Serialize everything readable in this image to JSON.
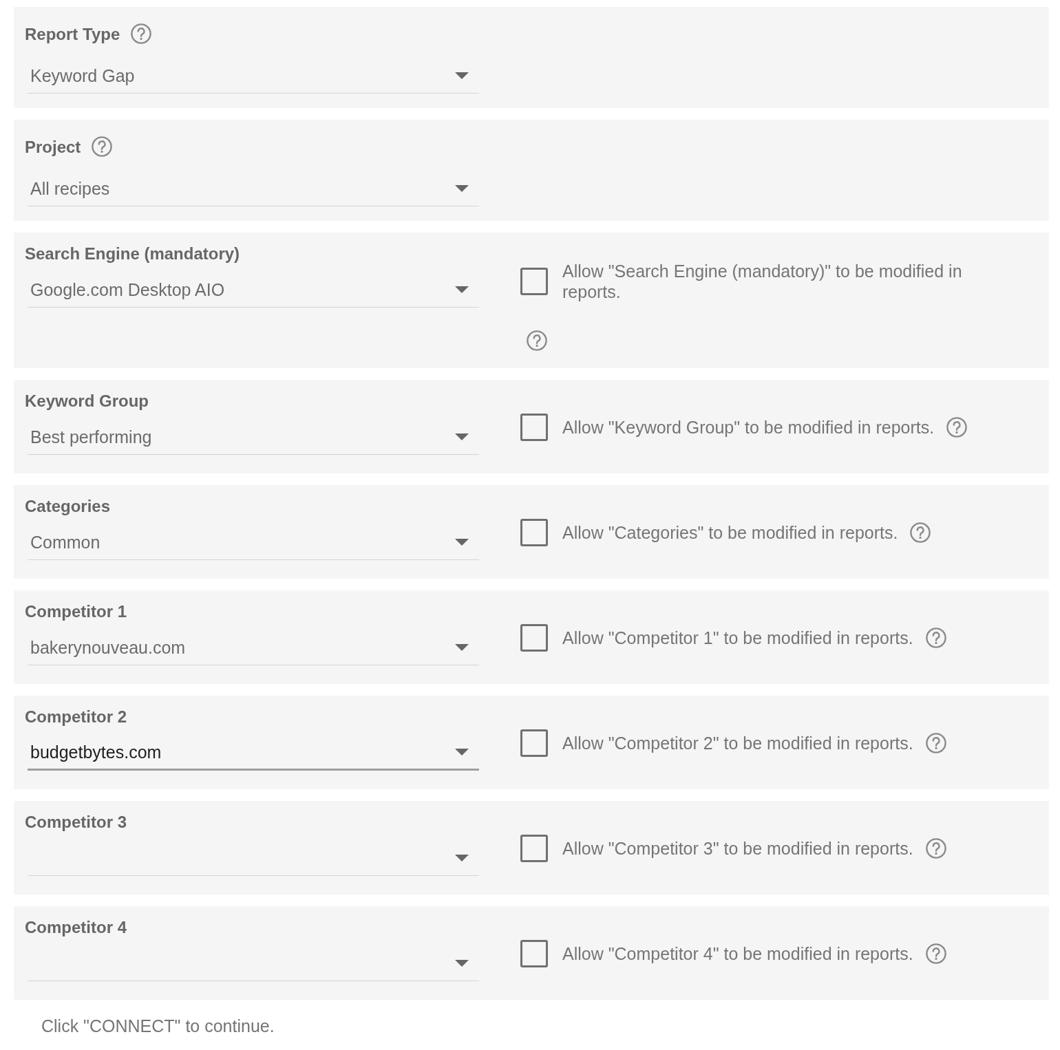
{
  "sections": [
    {
      "label": "Report Type",
      "help": true,
      "dropdown": {
        "value": "Keyword Gap",
        "focused": false
      }
    },
    {
      "label": "Project",
      "help": true,
      "dropdown": {
        "value": "All recipes",
        "focused": false
      }
    },
    {
      "label": "Search Engine (mandatory)",
      "help": false,
      "dropdown": {
        "value": "Google.com Desktop AIO",
        "focused": false
      },
      "allow_modify": {
        "text": "Allow \"Search Engine (mandatory)\" to be modified in reports.",
        "checked": false,
        "help": true
      }
    },
    {
      "label": "Keyword Group",
      "help": false,
      "dropdown": {
        "value": "Best performing",
        "focused": false
      },
      "allow_modify": {
        "text": "Allow \"Keyword Group\" to be modified in reports.",
        "checked": false,
        "help": true
      }
    },
    {
      "label": "Categories",
      "help": false,
      "dropdown": {
        "value": "Common",
        "focused": false
      },
      "allow_modify": {
        "text": "Allow \"Categories\" to be modified in reports.",
        "checked": false,
        "help": true
      }
    },
    {
      "label": "Competitor 1",
      "help": false,
      "dropdown": {
        "value": "bakerynouveau.com",
        "focused": false
      },
      "allow_modify": {
        "text": "Allow \"Competitor 1\" to be modified in reports.",
        "checked": false,
        "help": true
      }
    },
    {
      "label": "Competitor 2",
      "help": false,
      "dropdown": {
        "value": "budgetbytes.com",
        "focused": true
      },
      "allow_modify": {
        "text": "Allow \"Competitor 2\" to be modified in reports.",
        "checked": false,
        "help": true
      }
    },
    {
      "label": "Competitor 3",
      "help": false,
      "dropdown": {
        "focused": false
      },
      "allow_modify": {
        "text": "Allow \"Competitor 3\" to be modified in reports.",
        "checked": false,
        "help": true
      }
    },
    {
      "label": "Competitor 4",
      "help": false,
      "dropdown": {
        "focused": false
      },
      "allow_modify": {
        "text": "Allow \"Competitor 4\" to be modified in reports.",
        "checked": false,
        "help": true
      }
    }
  ],
  "footer": "Click \"CONNECT\" to continue."
}
